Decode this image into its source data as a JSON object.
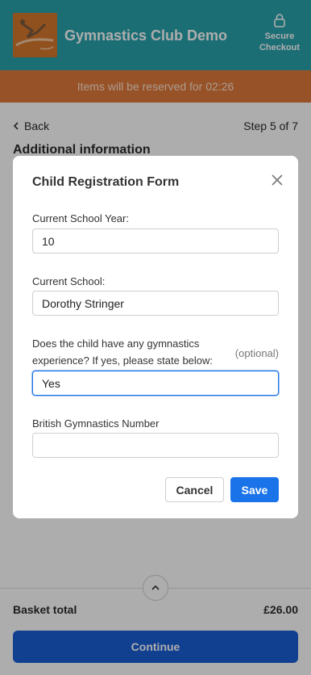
{
  "header": {
    "title": "Gymnastics Club Demo",
    "secure_line1": "Secure",
    "secure_line2": "Checkout",
    "logo_color": "#d4782f",
    "bg_color": "#2aa3ad"
  },
  "timer": {
    "text": "Items will be reserved for 02:26",
    "bg_color": "#e07a3a"
  },
  "nav": {
    "back_label": "Back",
    "step_text": "Step 5 of 7"
  },
  "page": {
    "section_title": "Additional information"
  },
  "footer": {
    "basket_label": "Basket total",
    "basket_total": "£26.00",
    "continue_label": "Continue"
  },
  "modal": {
    "title": "Child Registration Form",
    "fields": {
      "school_year": {
        "label": "Current School Year:",
        "value": "10"
      },
      "school": {
        "label": "Current School:",
        "value": "Dorothy Stringer"
      },
      "experience": {
        "label_line1": "Does the child have any gymnastics",
        "label_line2": "experience? If yes, please state below:",
        "optional": "(optional)",
        "value": "Yes"
      },
      "bg_number": {
        "label": "British Gymnastics Number",
        "value": ""
      }
    },
    "cancel_label": "Cancel",
    "save_label": "Save"
  }
}
